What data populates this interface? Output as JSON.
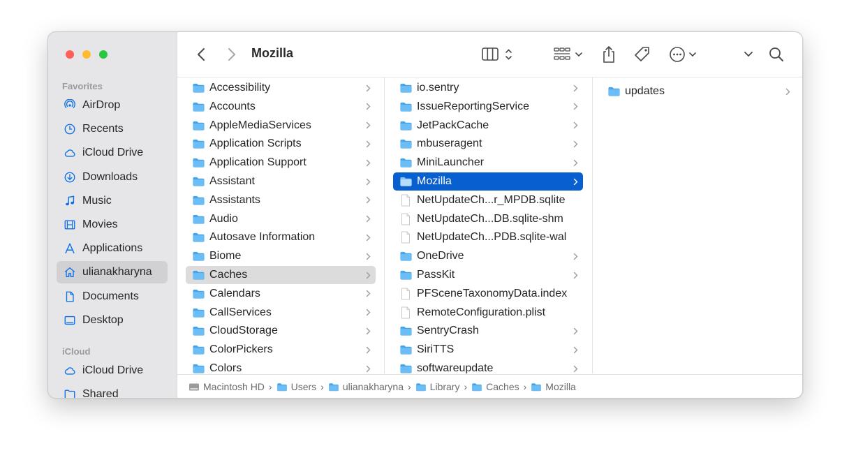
{
  "window": {
    "title": "Mozilla"
  },
  "sidebar": {
    "favorites_label": "Favorites",
    "icloud_label": "iCloud",
    "favorites": [
      {
        "label": "AirDrop",
        "icon": "airdrop-icon"
      },
      {
        "label": "Recents",
        "icon": "clock-icon"
      },
      {
        "label": "iCloud Drive",
        "icon": "cloud-icon"
      },
      {
        "label": "Downloads",
        "icon": "download-icon"
      },
      {
        "label": "Music",
        "icon": "music-note-icon"
      },
      {
        "label": "Movies",
        "icon": "film-icon"
      },
      {
        "label": "Applications",
        "icon": "applications-icon"
      },
      {
        "label": "ulianakharyna",
        "icon": "home-icon",
        "selected": true
      },
      {
        "label": "Documents",
        "icon": "document-icon"
      },
      {
        "label": "Desktop",
        "icon": "desktop-icon"
      }
    ],
    "icloud": [
      {
        "label": "iCloud Drive",
        "icon": "cloud-icon"
      },
      {
        "label": "Shared",
        "icon": "shared-folder-icon"
      }
    ]
  },
  "columns": {
    "col1": [
      "Accessibility",
      "Accounts",
      "AppleMediaServices",
      "Application Scripts",
      "Application Support",
      "Assistant",
      "Assistants",
      "Audio",
      "Autosave Information",
      "Biome",
      "Caches",
      "Calendars",
      "CallServices",
      "CloudStorage",
      "ColorPickers",
      "Colors"
    ],
    "col1_selected": "Caches",
    "col2": [
      {
        "label": "io.sentry",
        "type": "folder"
      },
      {
        "label": "IssueReportingService",
        "type": "folder"
      },
      {
        "label": "JetPackCache",
        "type": "folder"
      },
      {
        "label": "mbuseragent",
        "type": "folder"
      },
      {
        "label": "MiniLauncher",
        "type": "folder"
      },
      {
        "label": "Mozilla",
        "type": "folder",
        "selected": true
      },
      {
        "label": "NetUpdateCh...r_MPDB.sqlite",
        "type": "file"
      },
      {
        "label": "NetUpdateCh...DB.sqlite-shm",
        "type": "file"
      },
      {
        "label": "NetUpdateCh...PDB.sqlite-wal",
        "type": "file"
      },
      {
        "label": "OneDrive",
        "type": "folder"
      },
      {
        "label": "PassKit",
        "type": "folder"
      },
      {
        "label": "PFSceneTaxonomyData.index",
        "type": "file"
      },
      {
        "label": "RemoteConfiguration.plist",
        "type": "file"
      },
      {
        "label": "SentryCrash",
        "type": "folder"
      },
      {
        "label": "SiriTTS",
        "type": "folder"
      },
      {
        "label": "softwareupdate",
        "type": "folder"
      }
    ],
    "col3": [
      "updates"
    ]
  },
  "pathbar": [
    {
      "label": "Macintosh HD",
      "icon": "hard-drive-icon"
    },
    {
      "label": "Users",
      "icon": "folder-icon"
    },
    {
      "label": "ulianakharyna",
      "icon": "home-folder-icon"
    },
    {
      "label": "Library",
      "icon": "folder-icon"
    },
    {
      "label": "Caches",
      "icon": "folder-icon"
    },
    {
      "label": "Mozilla",
      "icon": "folder-icon"
    }
  ],
  "colors": {
    "accent": "#0860d0",
    "folder": "#5fb6f4",
    "folder_tab": "#47a4e8",
    "sidebar_icon": "#0a70e8"
  }
}
